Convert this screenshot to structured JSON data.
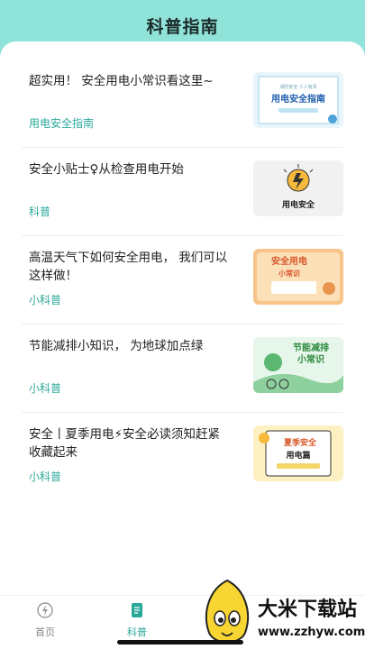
{
  "header": {
    "title": "科普指南"
  },
  "articles": [
    {
      "title": "超实用！ 安全用电小常识看这里~",
      "tag": "用电安全指南",
      "thumb": {
        "text": "用电安全指南",
        "small_top": "消防安全 人人有责",
        "bg": "#e8f5fb"
      }
    },
    {
      "title": "安全小贴士♀从检查用电开始",
      "tag": "科普",
      "thumb": {
        "text": "用电安全",
        "bg": "#f1f1f1"
      }
    },
    {
      "title": "高温天气下如何安全用电， 我们可以这样做！",
      "tag": "小科普",
      "thumb": {
        "text": "安全用电",
        "sub": "小常识",
        "bg": "#f7c48a"
      }
    },
    {
      "title": "节能减排小知识， 为地球加点绿",
      "tag": "小科普",
      "thumb": {
        "text": "节能减排",
        "sub": "小常识",
        "bg": "#e6f6ea"
      }
    },
    {
      "title": "安全丨夏季用电⚡安全必读须知赶紧收藏起来",
      "tag": "小科普",
      "thumb": {
        "text": "夏季安全",
        "sub": "用电篇",
        "bg": "#fdf0c2"
      }
    }
  ],
  "tabbar": {
    "items": [
      {
        "label": "首页",
        "icon": "lightning-icon"
      },
      {
        "label": "科普",
        "icon": "document-icon"
      }
    ]
  },
  "watermark": {
    "title": "大米下载站",
    "url": "www.zzhyw.com"
  },
  "colors": {
    "accent": "#2aa89a",
    "header_bg": "#8fe3d9"
  }
}
